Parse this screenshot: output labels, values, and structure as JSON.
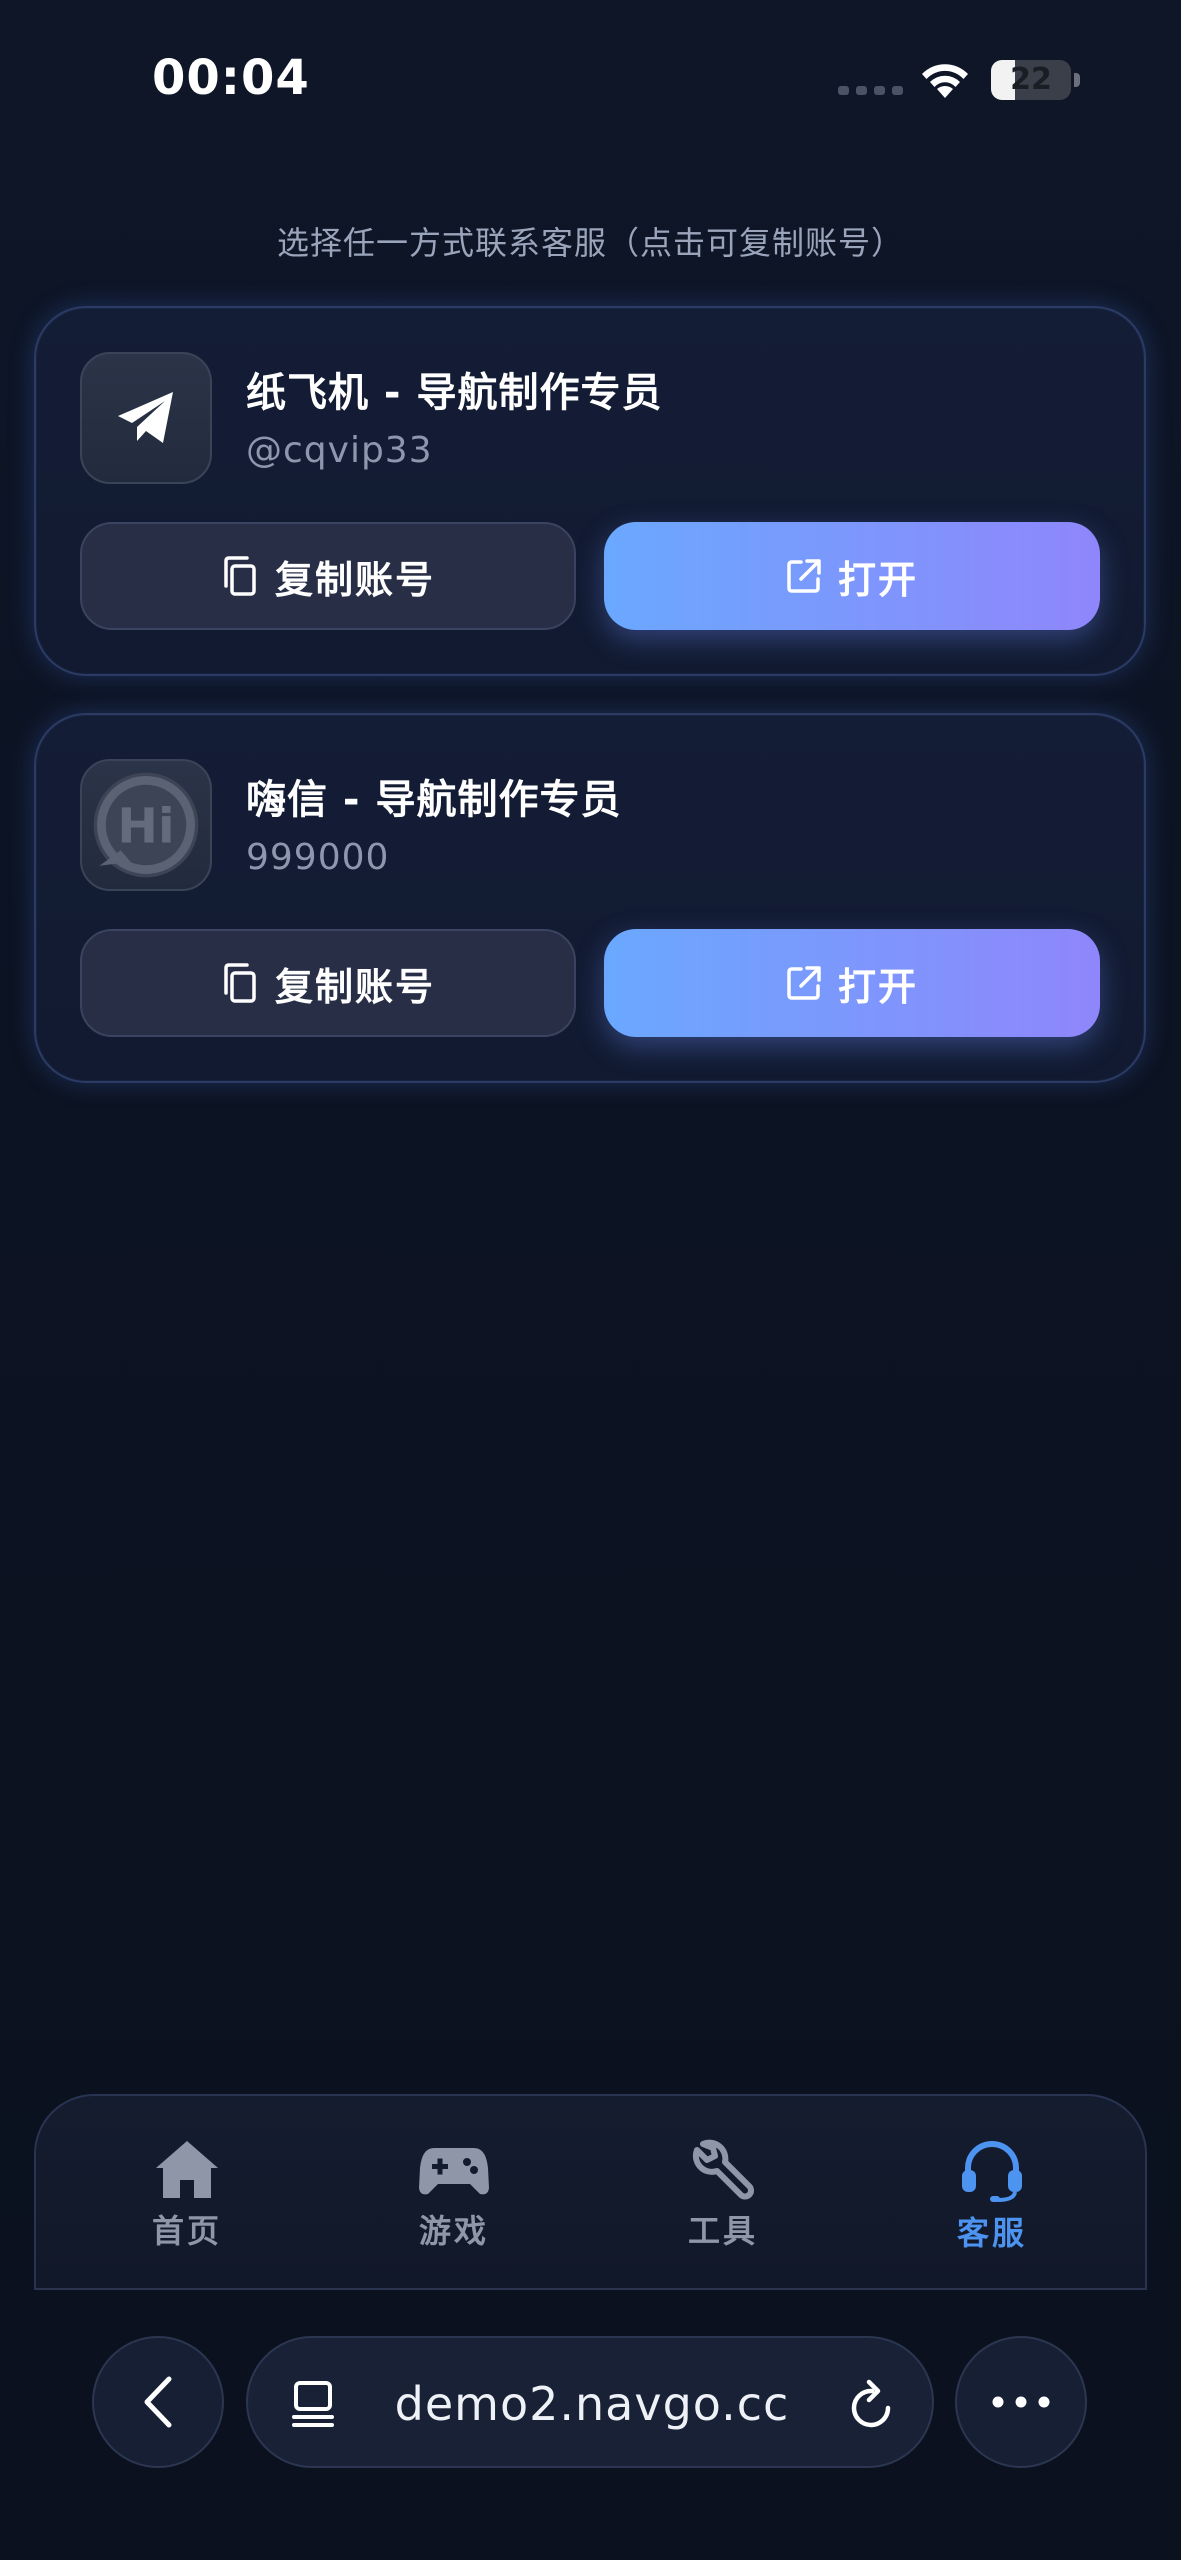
{
  "status_bar": {
    "time": "00:04",
    "battery_level": "22"
  },
  "hint": "选择任一方式联系客服（点击可复制账号）",
  "contacts": [
    {
      "name": "纸飞机 - 导航制作专员",
      "account": "@cqvip33",
      "icon": "paper-plane-icon",
      "copy_label": "复制账号",
      "open_label": "打开"
    },
    {
      "name": "嗨信 - 导航制作专员",
      "account": "999000",
      "icon": "hi-logo-icon",
      "logo_text": "Hi",
      "copy_label": "复制账号",
      "open_label": "打开"
    }
  ],
  "tabs": [
    {
      "label": "首页",
      "icon": "home-icon",
      "active": false
    },
    {
      "label": "游戏",
      "icon": "gamepad-icon",
      "active": false
    },
    {
      "label": "工具",
      "icon": "wrench-icon",
      "active": false
    },
    {
      "label": "客服",
      "icon": "headset-icon",
      "active": true
    }
  ],
  "browser": {
    "url": "demo2.navgo.cc"
  },
  "colors": {
    "accent": "#4d93f0",
    "button_gradient_start": "#6aa8ff",
    "button_gradient_end": "#8f86fb",
    "background": "#0c1220"
  }
}
